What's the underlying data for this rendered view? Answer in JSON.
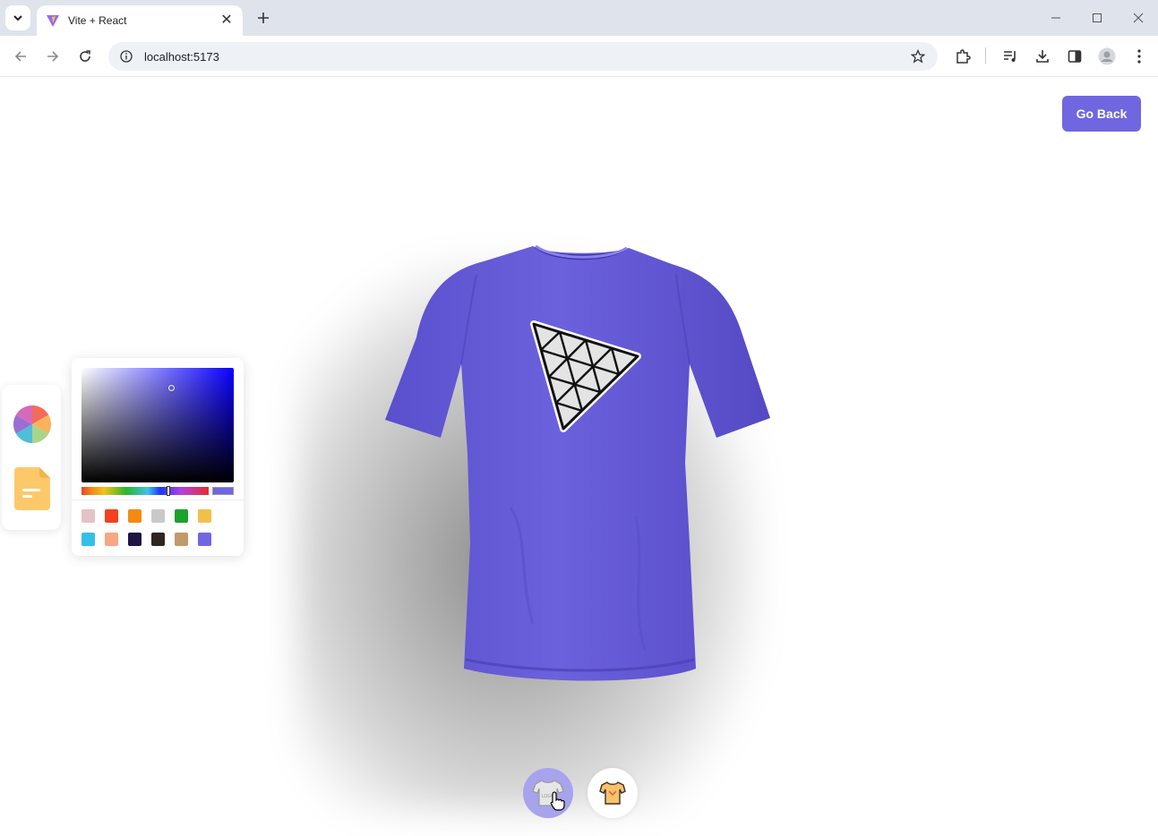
{
  "browser": {
    "tab_title": "Vite + React",
    "url": "localhost:5173",
    "icons": {
      "tab_search": "chevron-down-icon",
      "new_tab": "plus-icon",
      "back": "arrow-left-icon",
      "forward": "arrow-right-icon",
      "reload": "reload-icon",
      "site_info": "info-icon",
      "bookmark": "star-icon",
      "extensions": "puzzle-icon",
      "media": "media-queue-icon",
      "downloads": "download-icon",
      "side_panel": "side-panel-icon",
      "profile": "profile-icon",
      "menu": "kebab-menu-icon"
    }
  },
  "page": {
    "go_back_label": "Go Back",
    "accent_color": "#7066e0",
    "shirt_color": "#6a5fd6",
    "logo_decal": "triangle-grid-logo",
    "side_tabs": [
      {
        "name": "color-picker-tab",
        "icon": "color-wheel-icon"
      },
      {
        "name": "file-picker-tab",
        "icon": "file-icon"
      }
    ],
    "color_picker": {
      "hue_color": "#0a00ff",
      "current_color": "#7066e0",
      "swatches": [
        "#e4c2c8",
        "#f3411f",
        "#f58a12",
        "#c9c9c9",
        "#1ca12c",
        "#f1c04a",
        "#35bfe6",
        "#f7a782",
        "#1f1445",
        "#2f2523",
        "#c19a6b",
        "#7066e0"
      ]
    },
    "bottom_tabs": [
      {
        "name": "logo-shirt-tab",
        "icon": "shirt-logo-icon",
        "active": true
      },
      {
        "name": "stylish-shirt-tab",
        "icon": "shirt-icon",
        "active": false
      }
    ]
  }
}
